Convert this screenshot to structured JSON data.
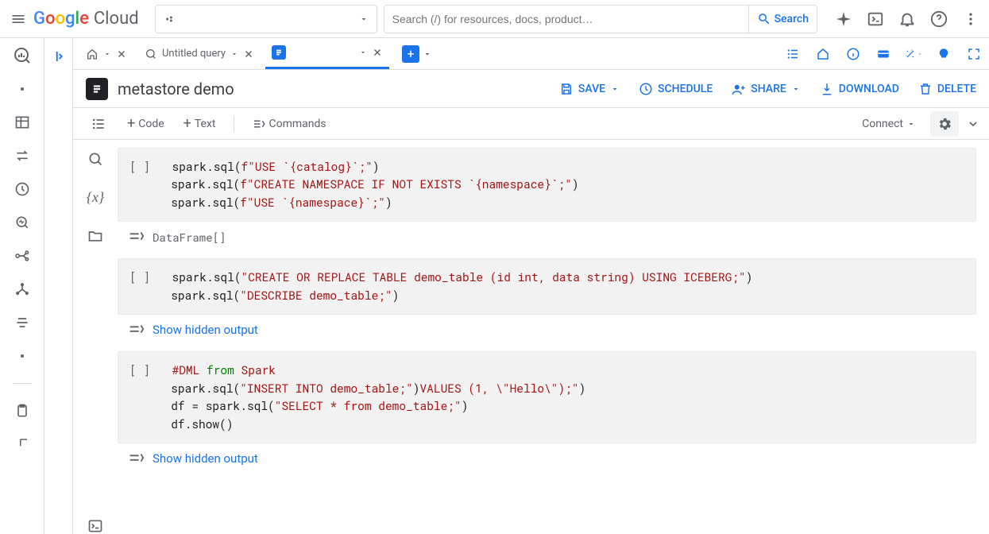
{
  "header": {
    "cloud_suffix": "Cloud",
    "search_placeholder": "Search (/) for resources, docs, product…",
    "search_button": "Search"
  },
  "tabs": {
    "untitled": "Untitled query"
  },
  "doc": {
    "title": "metastore demo",
    "save": "SAVE",
    "schedule": "SCHEDULE",
    "share": "SHARE",
    "download": "DOWNLOAD",
    "delete": "DELETE"
  },
  "nbtb": {
    "code": "Code",
    "text": "Text",
    "commands": "Commands",
    "connect": "Connect"
  },
  "cells": [
    {
      "lines": [
        [
          {
            "t": "[ ]",
            "c": "brackets"
          },
          {
            "t": "  spark.sql(",
            "c": "t-fn"
          },
          {
            "t": "f\"USE `",
            "c": "t-str"
          },
          {
            "t": "{catalog}",
            "c": "t-var"
          },
          {
            "t": "`;\"",
            "c": "t-str"
          },
          {
            "t": ")",
            "c": "t-fn"
          }
        ],
        [
          {
            "t": "      spark.sql(",
            "c": "t-fn"
          },
          {
            "t": "f\"CREATE NAMESPACE IF NOT EXISTS `",
            "c": "t-str"
          },
          {
            "t": "{namespace}",
            "c": "t-var"
          },
          {
            "t": "`;\"",
            "c": "t-str"
          },
          {
            "t": ")",
            "c": "t-fn"
          }
        ],
        [
          {
            "t": "      spark.sql(",
            "c": "t-fn"
          },
          {
            "t": "f\"USE `",
            "c": "t-str"
          },
          {
            "t": "{namespace}",
            "c": "t-var"
          },
          {
            "t": "`;\"",
            "c": "t-str"
          },
          {
            "t": ")",
            "c": "t-fn"
          }
        ]
      ],
      "out_text": "DataFrame[]"
    },
    {
      "lines": [
        [
          {
            "t": "[ ]",
            "c": "brackets"
          },
          {
            "t": "  spark.sql(",
            "c": "t-fn"
          },
          {
            "t": "\"CREATE OR REPLACE TABLE ",
            "c": "t-str"
          },
          {
            "t": "demo_table (id int, data string) USING ICEBERG;\"",
            "c": "t-com"
          },
          {
            "t": ")",
            "c": "t-fn"
          }
        ],
        [
          {
            "t": "      spark.sql(",
            "c": "t-fn"
          },
          {
            "t": "\"DESCRIBE ",
            "c": "t-str"
          },
          {
            "t": "demo_table;\"",
            "c": "t-com"
          },
          {
            "t": ")",
            "c": "t-fn"
          }
        ]
      ],
      "out_link": "Show hidden output"
    },
    {
      "lines": [
        [
          {
            "t": "[ ]",
            "c": "brackets"
          },
          {
            "t": "  #DML ",
            "c": "t-com"
          },
          {
            "t": "from",
            "c": "t-kw"
          },
          {
            "t": " Spark",
            "c": "t-com"
          }
        ],
        [
          {
            "t": "      spark.sql(",
            "c": "t-fn"
          },
          {
            "t": "\"INSERT INTO ",
            "c": "t-str"
          },
          {
            "t": "demo_table;\"",
            "c": "t-com"
          },
          {
            "t": ")",
            "c": "t-fn"
          },
          {
            "t": "VALUES (1, \\\"Hello\\\");\"",
            "c": "t-com"
          },
          {
            "t": ")",
            "c": "t-fn"
          }
        ],
        [
          {
            "t": "      df ",
            "c": "t-fn"
          },
          {
            "t": "=",
            "c": "t-fn"
          },
          {
            "t": " spark.sql(",
            "c": "t-fn"
          },
          {
            "t": "\"SELECT * from ",
            "c": "t-str"
          },
          {
            "t": "demo_table;\"",
            "c": "t-com"
          },
          {
            "t": ")",
            "c": "t-fn"
          }
        ],
        [
          {
            "t": "      df.show()",
            "c": "t-fn"
          }
        ]
      ],
      "out_link": "Show hidden output"
    }
  ]
}
